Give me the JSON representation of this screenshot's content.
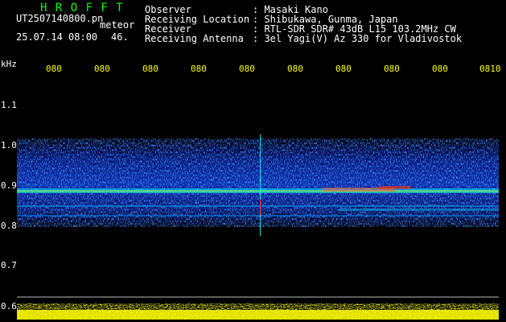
{
  "header": {
    "brand": "H R O F F T",
    "file_name": "UT2507140800.pn",
    "type": "meteor",
    "date_time": "25.07.14 08:00",
    "count": "46."
  },
  "info": [
    {
      "label": "Observer",
      "value": ": Masaki Kano"
    },
    {
      "label": "Receiving Location",
      "value": ": Shibukawa, Gunma, Japan"
    },
    {
      "label": "Receiver",
      "value": ": RTL-SDR SDR# 43dB L15 103.2MHz CW"
    },
    {
      "label": "Receiving Antenna",
      "value": ": 3el Yagi(V) Az 330 for Vladivostok"
    }
  ],
  "axis": {
    "unit": "kHz",
    "y_ticks": [
      "1.1",
      "1.0",
      "0.9",
      "0.8",
      "0.7",
      "0.6"
    ],
    "x_ticks": [
      "080",
      "080",
      "080",
      "080",
      "080",
      "080",
      "080",
      "080",
      "080",
      "0810"
    ]
  },
  "colors": {
    "background": "#000000",
    "text": "#ffffff",
    "tick": "#ffff00",
    "brand": "#00ff00"
  }
}
